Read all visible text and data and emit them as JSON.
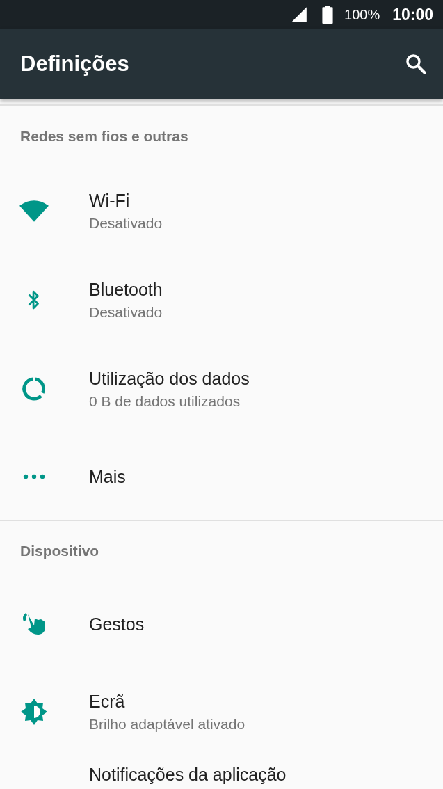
{
  "status_bar": {
    "battery": "100%",
    "time": "10:00"
  },
  "toolbar": {
    "title": "Definições"
  },
  "sections": [
    {
      "title": "Redes sem fios e outras",
      "items": [
        {
          "kind": "wifi",
          "title": "Wi-Fi",
          "summary": "Desativado"
        },
        {
          "kind": "bluetooth",
          "title": "Bluetooth",
          "summary": "Desativado"
        },
        {
          "kind": "data",
          "title": "Utilização dos dados",
          "summary": "0 B de dados utilizados"
        },
        {
          "kind": "more",
          "title": "Mais"
        }
      ]
    },
    {
      "title": "Dispositivo",
      "items": [
        {
          "kind": "gesture",
          "title": "Gestos"
        },
        {
          "kind": "display",
          "title": "Ecrã",
          "summary": "Brilho adaptável ativado"
        },
        {
          "title": "Notificações da aplicação"
        }
      ]
    }
  ]
}
